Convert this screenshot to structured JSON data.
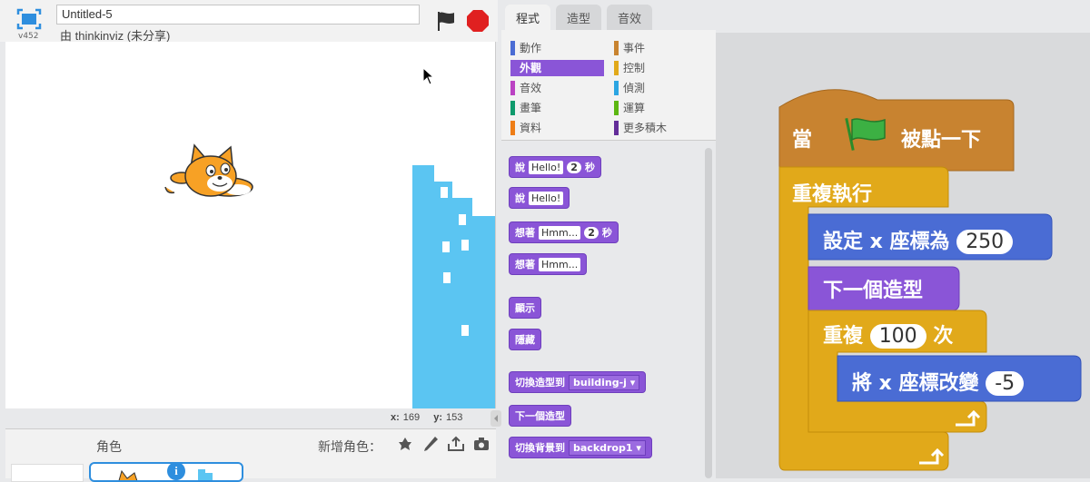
{
  "header": {
    "project_title": "Untitled-5",
    "author": "由 thinkinviz (未分享)",
    "version": "v452"
  },
  "stage": {
    "coords": {
      "x_label": "x:",
      "x_value": "169",
      "y_label": "y:",
      "y_value": "153"
    }
  },
  "sprite_pane": {
    "sprites_label": "角色",
    "new_sprite_label": "新增角色："
  },
  "tabs": [
    "程式",
    "造型",
    "音效"
  ],
  "categories": {
    "motion": "動作",
    "looks": "外觀",
    "sound": "音效",
    "pen": "畫筆",
    "data": "資料",
    "events": "事件",
    "control": "控制",
    "sensing": "偵測",
    "operators": "運算",
    "more": "更多積木"
  },
  "palette": {
    "say_for": {
      "cmd": "說",
      "text": "Hello!",
      "secs": "2",
      "unit": "秒"
    },
    "say": {
      "cmd": "說",
      "text": "Hello!"
    },
    "think_for": {
      "cmd": "想著",
      "text": "Hmm...",
      "secs": "2",
      "unit": "秒"
    },
    "think": {
      "cmd": "想著",
      "text": "Hmm..."
    },
    "show": "顯示",
    "hide": "隱藏",
    "switch_costume": {
      "cmd": "切換造型到",
      "value": "building-j"
    },
    "next_costume": "下一個造型",
    "switch_backdrop": {
      "cmd": "切換背景到",
      "value": "backdrop1"
    }
  },
  "script": {
    "hat": {
      "pre": "當",
      "post": "被點一下"
    },
    "forever": "重複執行",
    "set_x": {
      "text": "設定 x 座標為",
      "value": "250"
    },
    "next_costume": "下一個造型",
    "repeat": {
      "pre": "重複",
      "value": "100",
      "post": "次"
    },
    "change_x": {
      "text": "將 x 座標改變",
      "value": "-5"
    }
  },
  "colors": {
    "looks": "#8a55d7",
    "motion": "#4a6cd4",
    "control": "#e1a91a",
    "events": "#c88330",
    "building": "#5bc5f2"
  }
}
